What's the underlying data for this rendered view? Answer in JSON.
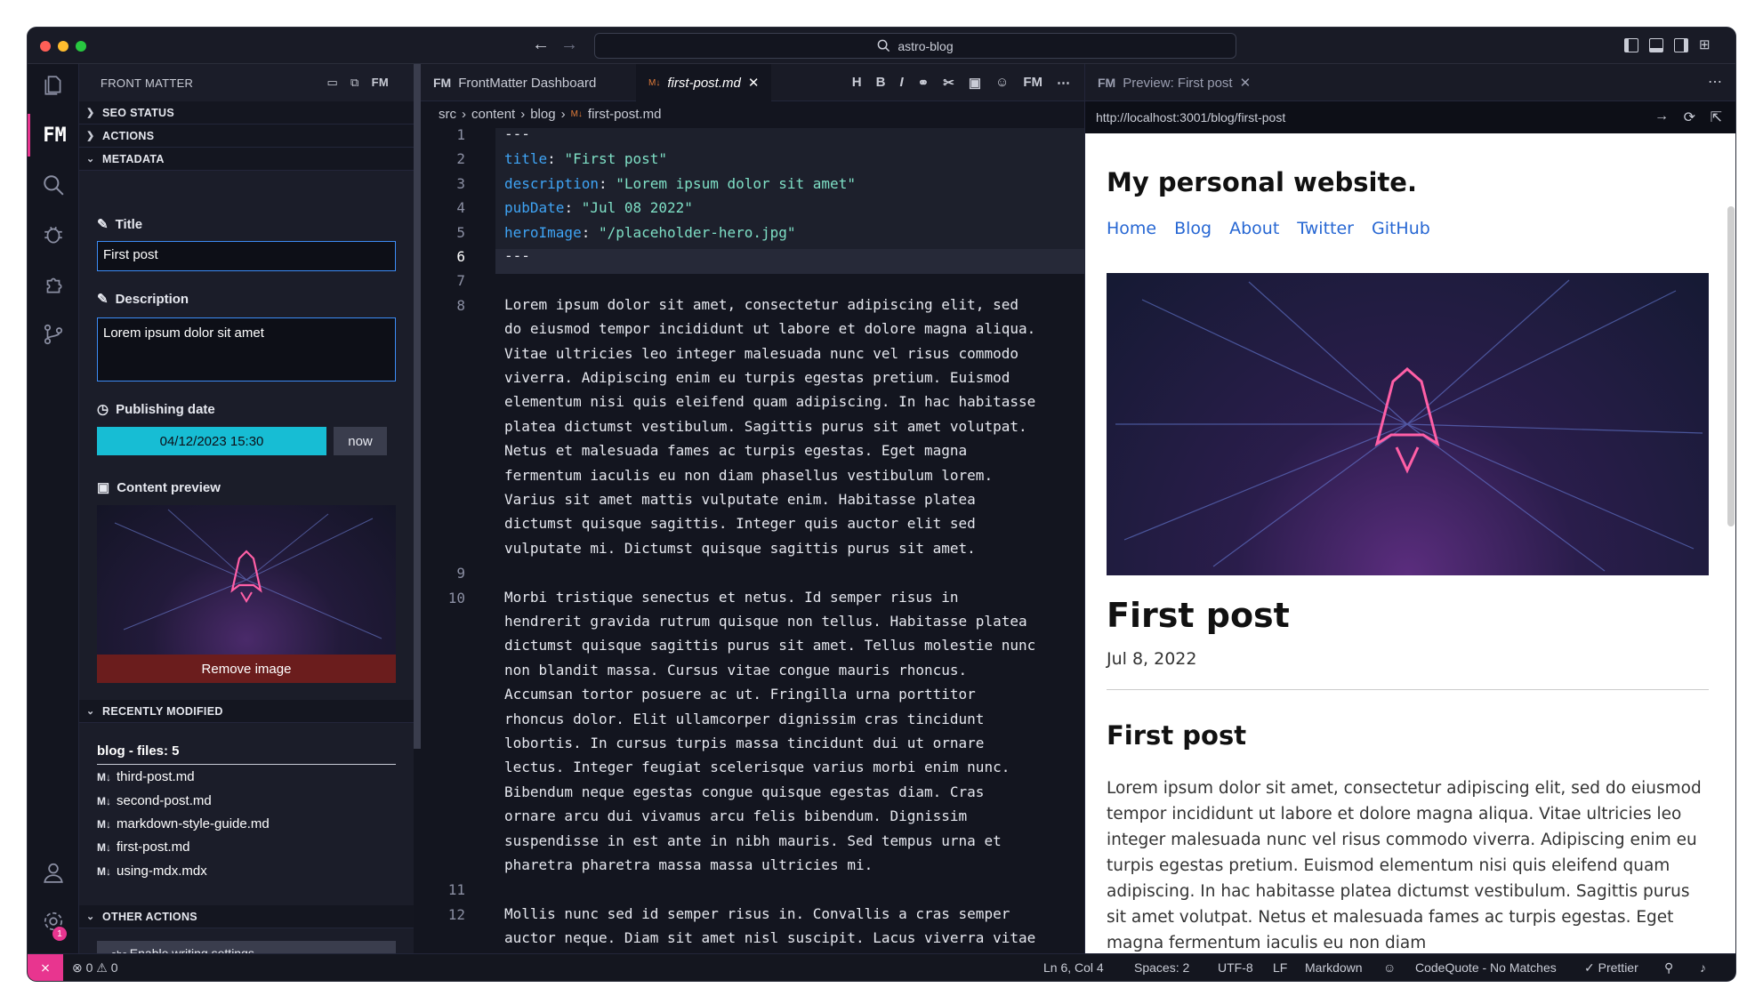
{
  "window": {
    "search": "astro-blog"
  },
  "sidebar": {
    "title": "FRONT MATTER",
    "sections": {
      "seo": "SEO STATUS",
      "actions": "ACTIONS",
      "metadata": "METADATA",
      "recent": "RECENTLY MODIFIED",
      "other": "OTHER ACTIONS"
    },
    "fields": {
      "title_label": "Title",
      "title_value": "First post",
      "desc_label": "Description",
      "desc_value": "Lorem ipsum dolor sit amet",
      "date_label": "Publishing date",
      "date_value": "04/12/2023 15:30",
      "now_label": "now",
      "preview_label": "Content preview",
      "remove_label": "Remove image"
    },
    "recent": {
      "group": "blog - files: 5",
      "files": [
        "third-post.md",
        "second-post.md",
        "markdown-style-guide.md",
        "first-post.md",
        "using-mdx.mdx"
      ]
    },
    "other_action": "Enable writing settings"
  },
  "editor": {
    "tabs": [
      "FrontMatter Dashboard",
      "first-post.md"
    ],
    "breadcrumb": [
      "src",
      "content",
      "blog",
      "first-post.md"
    ],
    "lines": [
      {
        "n": "1",
        "text": "---"
      },
      {
        "n": "2",
        "key": "title",
        "val": "\"First post\""
      },
      {
        "n": "3",
        "key": "description",
        "val": "\"Lorem ipsum dolor sit amet\""
      },
      {
        "n": "4",
        "key": "pubDate",
        "val": "\"Jul 08 2022\""
      },
      {
        "n": "5",
        "key": "heroImage",
        "val": "\"/placeholder-hero.jpg\""
      },
      {
        "n": "6",
        "text": "---"
      },
      {
        "n": "7",
        "text": ""
      },
      {
        "n": "8",
        "text": "Lorem ipsum dolor sit amet, consectetur adipiscing elit, sed\ndo eiusmod tempor incididunt ut labore et dolore magna aliqua.\nVitae ultricies leo integer malesuada nunc vel risus commodo\nviverra. Adipiscing enim eu turpis egestas pretium. Euismod\nelementum nisi quis eleifend quam adipiscing. In hac habitasse\nplatea dictumst vestibulum. Sagittis purus sit amet volutpat.\nNetus et malesuada fames ac turpis egestas. Eget magna\nfermentum iaculis eu non diam phasellus vestibulum lorem.\nVarius sit amet mattis vulputate enim. Habitasse platea\ndictumst quisque sagittis. Integer quis auctor elit sed\nvulputate mi. Dictumst quisque sagittis purus sit amet."
      },
      {
        "n": "9",
        "text": ""
      },
      {
        "n": "10",
        "text": "Morbi tristique senectus et netus. Id semper risus in\nhendrerit gravida rutrum quisque non tellus. Habitasse platea\ndictumst quisque sagittis purus sit amet. Tellus molestie nunc\nnon blandit massa. Cursus vitae congue mauris rhoncus.\nAccumsan tortor posuere ac ut. Fringilla urna porttitor\nrhoncus dolor. Elit ullamcorper dignissim cras tincidunt\nlobortis. In cursus turpis massa tincidunt dui ut ornare\nlectus. Integer feugiat scelerisque varius morbi enim nunc.\nBibendum neque egestas congue quisque egestas diam. Cras\nornare arcu dui vivamus arcu felis bibendum. Dignissim\nsuspendisse in est ante in nibh mauris. Sed tempus urna et\npharetra pharetra massa massa ultricies mi."
      },
      {
        "n": "11",
        "text": ""
      },
      {
        "n": "12",
        "text": "Mollis nunc sed id semper risus in. Convallis a cras semper\nauctor neque. Diam sit amet nisl suscipit. Lacus viverra vitae"
      }
    ]
  },
  "preview": {
    "tab": "Preview: First post",
    "url": "http://localhost:3001/blog/first-post",
    "site_title": "My personal website.",
    "nav": [
      "Home",
      "Blog",
      "About",
      "Twitter",
      "GitHub"
    ],
    "h1": "First post",
    "date": "Jul 8, 2022",
    "h2": "First post",
    "para": "Lorem ipsum dolor sit amet, consectetur adipiscing elit, sed do eiusmod tempor incididunt ut labore et dolore magna aliqua. Vitae ultricies leo integer malesuada nunc vel risus commodo viverra. Adipiscing enim eu turpis egestas pretium. Euismod elementum nisi quis eleifend quam adipiscing. In hac habitasse platea dictumst vestibulum. Sagittis purus sit amet volutpat. Netus et malesuada fames ac turpis egestas. Eget magna fermentum iaculis eu non diam"
  },
  "status": {
    "errors": "0",
    "warnings": "0",
    "position": "Ln 6, Col 4",
    "spaces": "Spaces: 2",
    "encoding": "UTF-8",
    "eol": "LF",
    "lang": "Markdown",
    "codequote": "CodeQuote - No Matches",
    "prettier": "Prettier",
    "badge": "1"
  },
  "colors": {
    "accent": "#e8358f",
    "date_button": "#17bdd4",
    "remove_button": "#6b1d1d",
    "key": "#3fa4f5",
    "string": "#7fe0c6"
  }
}
